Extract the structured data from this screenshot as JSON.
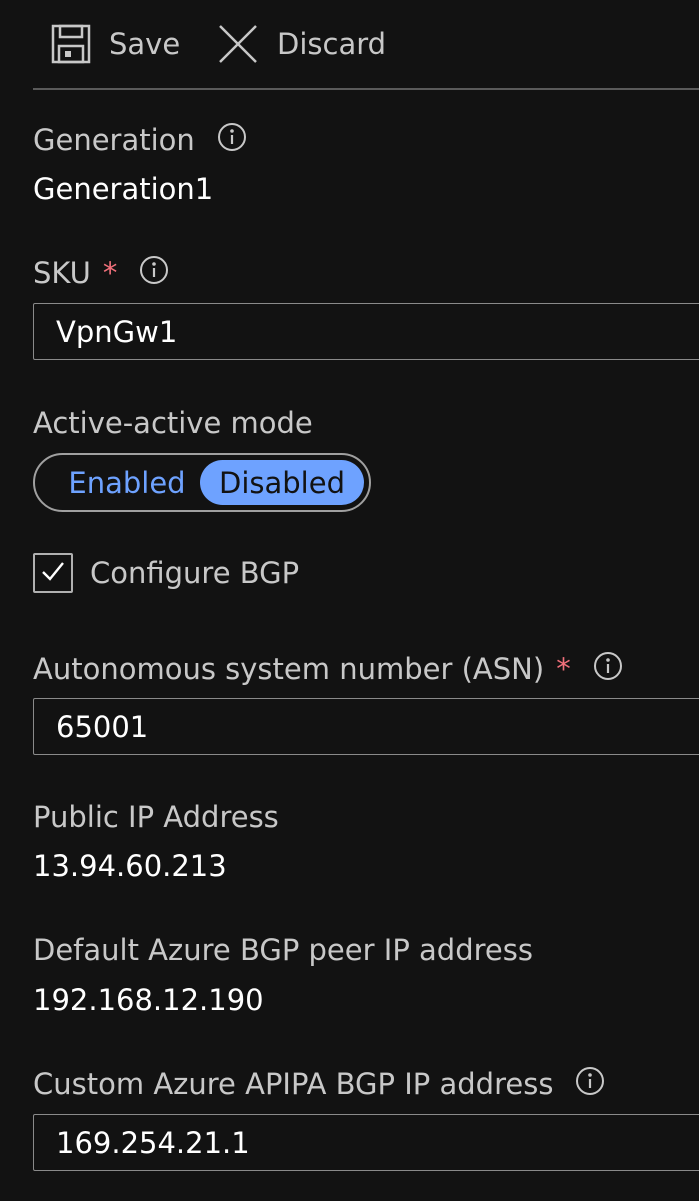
{
  "toolbar": {
    "save_label": "Save",
    "save_icon": "save-icon",
    "discard_label": "Discard",
    "discard_icon": "close-icon"
  },
  "generation": {
    "label": "Generation",
    "value": "Generation1"
  },
  "sku": {
    "label": "SKU",
    "required_mark": "*",
    "value": "VpnGw1"
  },
  "active_active": {
    "label": "Active-active mode",
    "options": [
      "Enabled",
      "Disabled"
    ],
    "selected": "Disabled"
  },
  "configure_bgp": {
    "label": "Configure BGP",
    "checked": true
  },
  "asn": {
    "label": "Autonomous system number (ASN)",
    "required_mark": "*",
    "value": "65001"
  },
  "public_ip": {
    "label": "Public IP Address",
    "value": "13.94.60.213"
  },
  "default_bgp_peer": {
    "label": "Default Azure BGP peer IP address",
    "value": "192.168.12.190"
  },
  "custom_apipa": {
    "label": "Custom Azure APIPA BGP IP address",
    "value": "169.254.21.1"
  },
  "colors": {
    "background": "#121212",
    "accent": "#6ea2ff",
    "required": "#f1707b",
    "label": "#c8c8c8",
    "value": "#ffffff"
  }
}
